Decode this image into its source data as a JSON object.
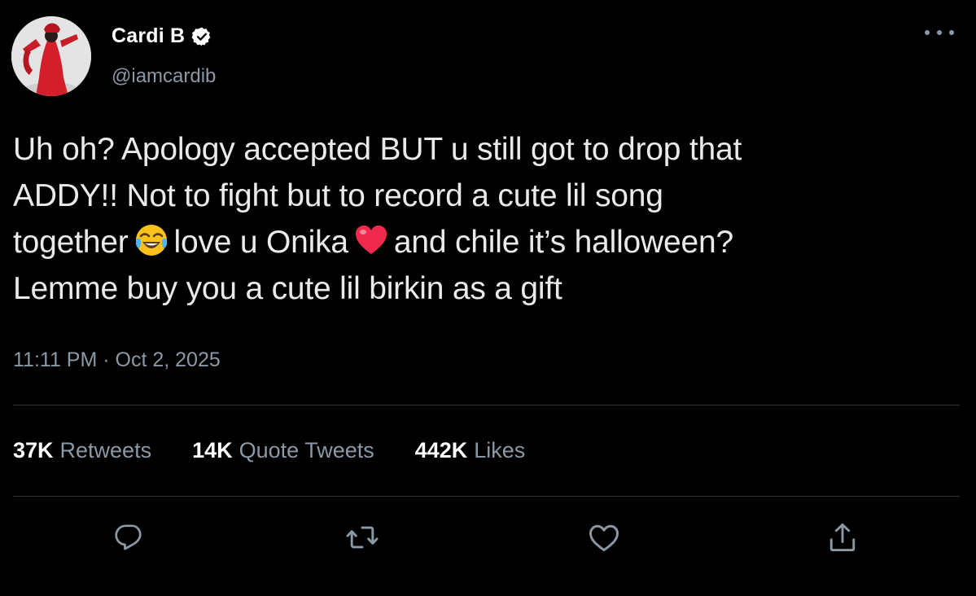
{
  "author": {
    "display_name": "Cardi B",
    "handle": "@iamcardib",
    "verified_icon": "verified-badge-icon",
    "avatar_icon": "avatar-image"
  },
  "tweet": {
    "lines": [
      "Uh oh? Apology accepted BUT u still got to drop that",
      "ADDY!! Not to fight but to record a cute lil song"
    ],
    "line3_part1": "together",
    "line3_emoji1": "😂",
    "line3_part2": "love u Onika",
    "line3_emoji2": "❤️",
    "line3_part3": "and chile it’s halloween?",
    "line4": "Lemme buy you a cute lil birkin as a gift",
    "timestamp": "11:11 PM · Oct 2, 2025"
  },
  "stats": {
    "retweets_count": "37K",
    "retweets_label": "Retweets",
    "quotes_count": "14K",
    "quotes_label": "Quote Tweets",
    "likes_count": "442K",
    "likes_label": "Likes"
  },
  "actions": {
    "reply_icon": "reply-icon",
    "retweet_icon": "retweet-icon",
    "like_icon": "like-icon",
    "share_icon": "share-icon",
    "more_icon": "more-options-icon"
  },
  "colors": {
    "background": "#000000",
    "text": "#e7e9ea",
    "secondary": "#8b98a5",
    "divider": "#2f3336",
    "heart": "#e0245e"
  }
}
